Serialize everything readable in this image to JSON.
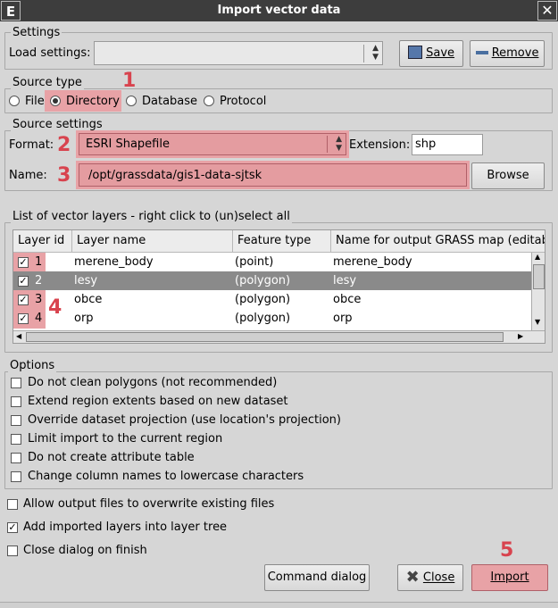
{
  "window": {
    "title": "Import vector data",
    "app_icon": "E",
    "close_icon": "close-icon"
  },
  "settings": {
    "group": "Settings",
    "load_label": "Load settings:",
    "save": "Save",
    "remove": "Remove"
  },
  "source_type": {
    "group": "Source type",
    "options": [
      "File",
      "Directory",
      "Database",
      "Protocol"
    ],
    "selected": "Directory"
  },
  "source_settings": {
    "group": "Source settings",
    "format_label": "Format:",
    "format_value": "ESRI Shapefile",
    "extension_label": "Extension:",
    "extension_value": "shp",
    "name_label": "Name:",
    "name_value": "/opt/grassdata/gis1-data-sjtsk",
    "browse": "Browse"
  },
  "layers": {
    "group": "List of vector layers - right click to (un)select all",
    "columns": [
      "Layer id",
      "Layer name",
      "Feature type",
      "Name for output GRASS map (editab"
    ],
    "rows": [
      {
        "id": "1",
        "name": "merene_body",
        "type": "(point)",
        "output": "merene_body",
        "checked": true,
        "selected": false
      },
      {
        "id": "2",
        "name": "lesy",
        "type": "(polygon)",
        "output": "lesy",
        "checked": true,
        "selected": true
      },
      {
        "id": "3",
        "name": "obce",
        "type": "(polygon)",
        "output": "obce",
        "checked": true,
        "selected": false
      },
      {
        "id": "4",
        "name": "orp",
        "type": "(polygon)",
        "output": "orp",
        "checked": true,
        "selected": false
      }
    ]
  },
  "options": {
    "group": "Options",
    "items": [
      {
        "label": "Do not clean polygons (not recommended)",
        "checked": false
      },
      {
        "label": "Extend region extents based on new dataset",
        "checked": false
      },
      {
        "label": "Override dataset projection (use location's projection)",
        "checked": false
      },
      {
        "label": "Limit import to the current region",
        "checked": false
      },
      {
        "label": "Do not create attribute table",
        "checked": false
      },
      {
        "label": "Change column names to lowercase characters",
        "checked": false
      }
    ]
  },
  "general": {
    "items": [
      {
        "label": "Allow output files to overwrite existing files",
        "checked": false
      },
      {
        "label": "Add imported layers into layer tree",
        "checked": true
      },
      {
        "label": "Close dialog on finish",
        "checked": false
      }
    ]
  },
  "buttons": {
    "command": "Command dialog",
    "close": "Close",
    "import": "Import"
  },
  "markers": [
    "1",
    "2",
    "3",
    "4",
    "5"
  ],
  "colors": {
    "highlight": "#e8a2a6",
    "marker": "#d8434e",
    "titlebar": "#3d3d3d"
  }
}
